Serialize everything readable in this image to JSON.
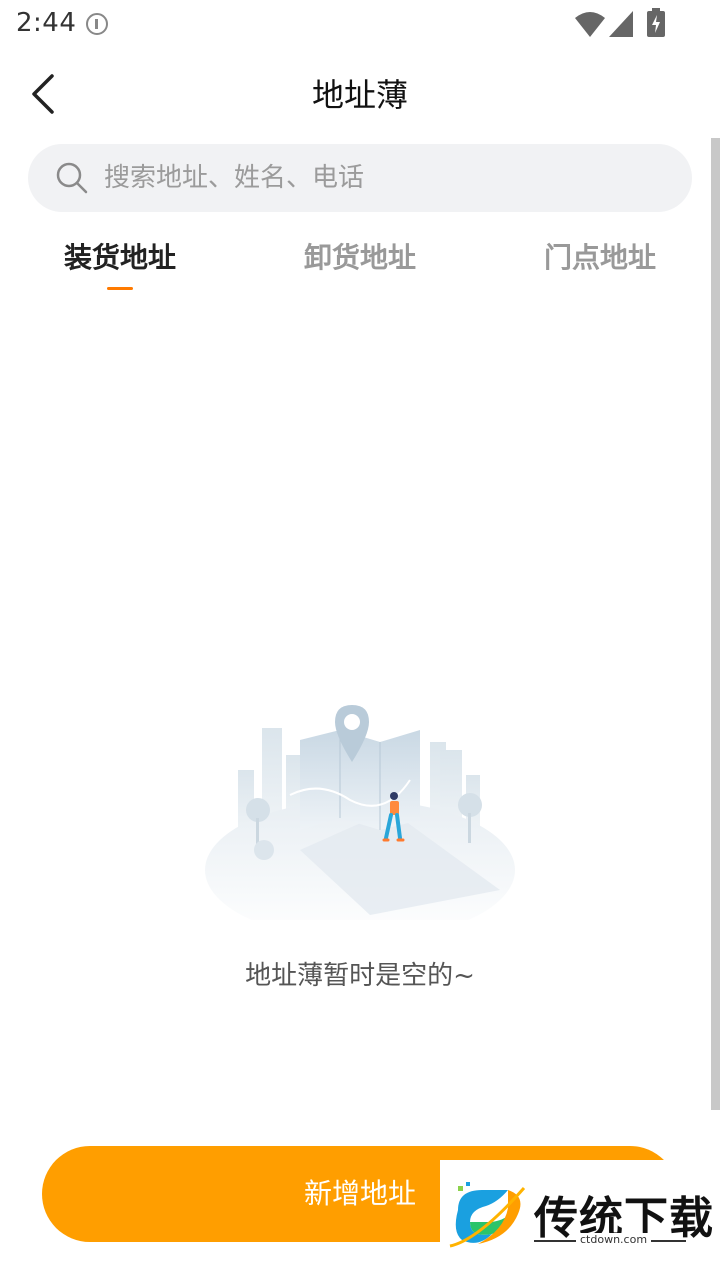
{
  "status_bar": {
    "time": "2:44",
    "icons": [
      "info-icon",
      "wifi-icon",
      "signal-icon",
      "battery-charging-icon"
    ]
  },
  "header": {
    "title": "地址薄",
    "back_icon": "chevron-left-icon"
  },
  "search": {
    "placeholder": "搜索地址、姓名、电话",
    "value": ""
  },
  "tabs": [
    {
      "label": "装货地址",
      "active": true
    },
    {
      "label": "卸货地址",
      "active": false
    },
    {
      "label": "门点地址",
      "active": false
    }
  ],
  "empty_state": {
    "message": "地址薄暂时是空的~"
  },
  "footer": {
    "add_label": "新增地址"
  },
  "watermark": {
    "title": "传统下载",
    "subtitle": "ctdown.com"
  },
  "colors": {
    "accent": "#ff9e00",
    "indicator": "#ff7a00",
    "search_bg": "#f1f2f4"
  }
}
